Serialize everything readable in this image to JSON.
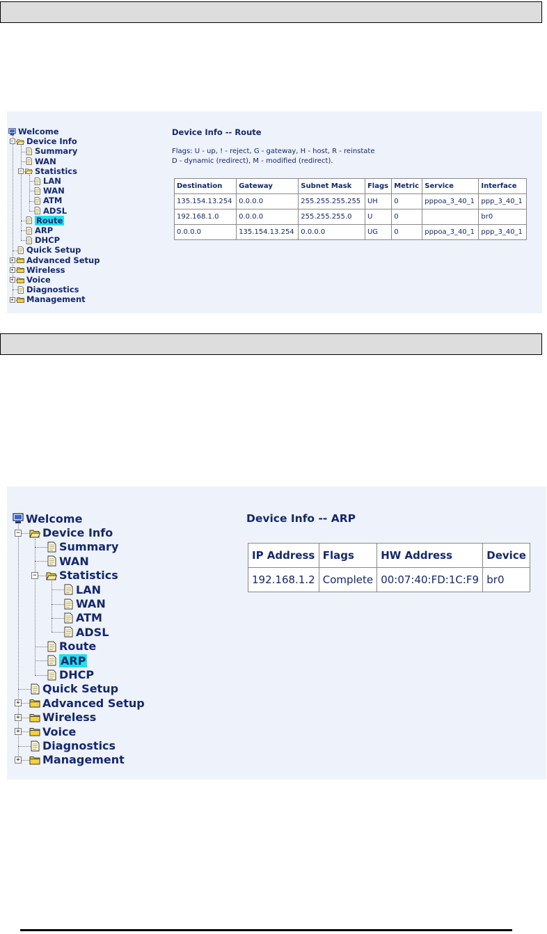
{
  "route_panel": {
    "tree": [
      {
        "label": "Welcome",
        "icon": "computer-icon"
      },
      {
        "label": "Device Info",
        "icon": "folder-open-icon"
      },
      {
        "label": "Summary",
        "icon": "document-icon"
      },
      {
        "label": "WAN",
        "icon": "document-icon"
      },
      {
        "label": "Statistics",
        "icon": "folder-open-icon"
      },
      {
        "label": "LAN",
        "icon": "document-icon"
      },
      {
        "label": "WAN",
        "icon": "document-icon"
      },
      {
        "label": "ATM",
        "icon": "document-icon"
      },
      {
        "label": "ADSL",
        "icon": "document-icon"
      },
      {
        "label": "Route",
        "icon": "document-icon",
        "selected": true
      },
      {
        "label": "ARP",
        "icon": "document-icon"
      },
      {
        "label": "DHCP",
        "icon": "document-icon"
      },
      {
        "label": "Quick Setup",
        "icon": "document-icon"
      },
      {
        "label": "Advanced Setup",
        "icon": "folder-closed-icon"
      },
      {
        "label": "Wireless",
        "icon": "folder-closed-icon"
      },
      {
        "label": "Voice",
        "icon": "folder-closed-icon"
      },
      {
        "label": "Diagnostics",
        "icon": "document-icon"
      },
      {
        "label": "Management",
        "icon": "folder-closed-icon"
      }
    ],
    "title": "Device Info -- Route",
    "flags_line1": "Flags: U - up, ! - reject, G - gateway, H - host, R - reinstate",
    "flags_line2": "D - dynamic (redirect), M - modified (redirect).",
    "headers": [
      "Destination",
      "Gateway",
      "Subnet Mask",
      "Flags",
      "Metric",
      "Service",
      "Interface"
    ],
    "rows": [
      [
        "135.154.13.254",
        "0.0.0.0",
        "255.255.255.255",
        "UH",
        "0",
        "pppoa_3_40_1",
        "ppp_3_40_1"
      ],
      [
        "192.168.1.0",
        "0.0.0.0",
        "255.255.255.0",
        "U",
        "0",
        "",
        "br0"
      ],
      [
        "0.0.0.0",
        "135.154.13.254",
        "0.0.0.0",
        "UG",
        "0",
        "pppoa_3_40_1",
        "ppp_3_40_1"
      ]
    ]
  },
  "arp_panel": {
    "tree": [
      {
        "label": "Welcome",
        "icon": "computer-icon"
      },
      {
        "label": "Device Info",
        "icon": "folder-open-icon"
      },
      {
        "label": "Summary",
        "icon": "document-icon"
      },
      {
        "label": "WAN",
        "icon": "document-icon"
      },
      {
        "label": "Statistics",
        "icon": "folder-open-icon"
      },
      {
        "label": "LAN",
        "icon": "document-icon"
      },
      {
        "label": "WAN",
        "icon": "document-icon"
      },
      {
        "label": "ATM",
        "icon": "document-icon"
      },
      {
        "label": "ADSL",
        "icon": "document-icon"
      },
      {
        "label": "Route",
        "icon": "document-icon"
      },
      {
        "label": "ARP",
        "icon": "document-icon",
        "selected": true
      },
      {
        "label": "DHCP",
        "icon": "document-icon"
      },
      {
        "label": "Quick Setup",
        "icon": "document-icon"
      },
      {
        "label": "Advanced Setup",
        "icon": "folder-closed-icon"
      },
      {
        "label": "Wireless",
        "icon": "folder-closed-icon"
      },
      {
        "label": "Voice",
        "icon": "folder-closed-icon"
      },
      {
        "label": "Diagnostics",
        "icon": "document-icon"
      },
      {
        "label": "Management",
        "icon": "folder-closed-icon"
      }
    ],
    "title": "Device Info -- ARP",
    "headers": [
      "IP Address",
      "Flags",
      "HW Address",
      "Device"
    ],
    "rows": [
      [
        "192.168.1.2",
        "Complete",
        "00:07:40:FD:1C:F9",
        "br0"
      ]
    ]
  },
  "colors": {
    "panel_bg": "#eef2fa",
    "text": "#14286b",
    "selected_highlight": "#20e0ee",
    "header_bar": "#dddddd",
    "folder": "#f5d23c"
  }
}
